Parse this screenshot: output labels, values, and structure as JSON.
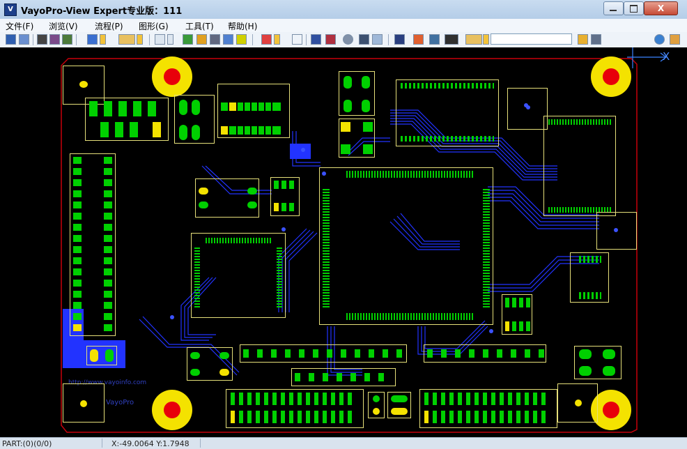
{
  "window": {
    "title": "VayoPro-View Expert专业版：111",
    "icon_name": "vayo-logo-icon",
    "close_label": "X"
  },
  "menu": {
    "items": [
      {
        "label": "文件(F)"
      },
      {
        "label": "浏览(V)"
      },
      {
        "label": "流程(P)"
      },
      {
        "label": "图形(G)"
      },
      {
        "label": "工具(T)"
      },
      {
        "label": "帮助(H)"
      }
    ]
  },
  "toolbar": {
    "icons": [
      "save-icon",
      "save-as-icon",
      "grid-icon",
      "layer-icon",
      "board-icon",
      "view-icon",
      "dropdown-icon",
      "folder-icon",
      "dropdown-icon",
      "zoom-icon",
      "dropdown-icon",
      "list-icon",
      "color-icon",
      "rect-icon",
      "select-icon",
      "points-icon",
      "filter-icon",
      "dropdown-icon",
      "window-icon",
      "panel-icon",
      "panel2-icon",
      "target-icon",
      "binoculars-icon",
      "measure-icon",
      "bars-icon",
      "color-bars-icon",
      "image-icon",
      "chip-icon",
      "eraser-icon",
      "dropdown-icon",
      "settings-icon",
      "report-icon",
      "globe-icon",
      "home-icon"
    ],
    "search_value": ""
  },
  "canvas": {
    "axis_label": "X",
    "silk_text": "http://www.vayoinfo.com",
    "brand_text": "VayoPro",
    "colors": {
      "background": "#000000",
      "trace": "#2233ff",
      "pad": "#00d000",
      "outline": "#e6e07a",
      "mount_ring": "#f4e200",
      "mount_hole": "#e8000a",
      "board_edge": "#c8000a"
    }
  },
  "status": {
    "part": "PART:(0)(0/0)",
    "coords": "X:-49.0064 Y:1.7948"
  }
}
